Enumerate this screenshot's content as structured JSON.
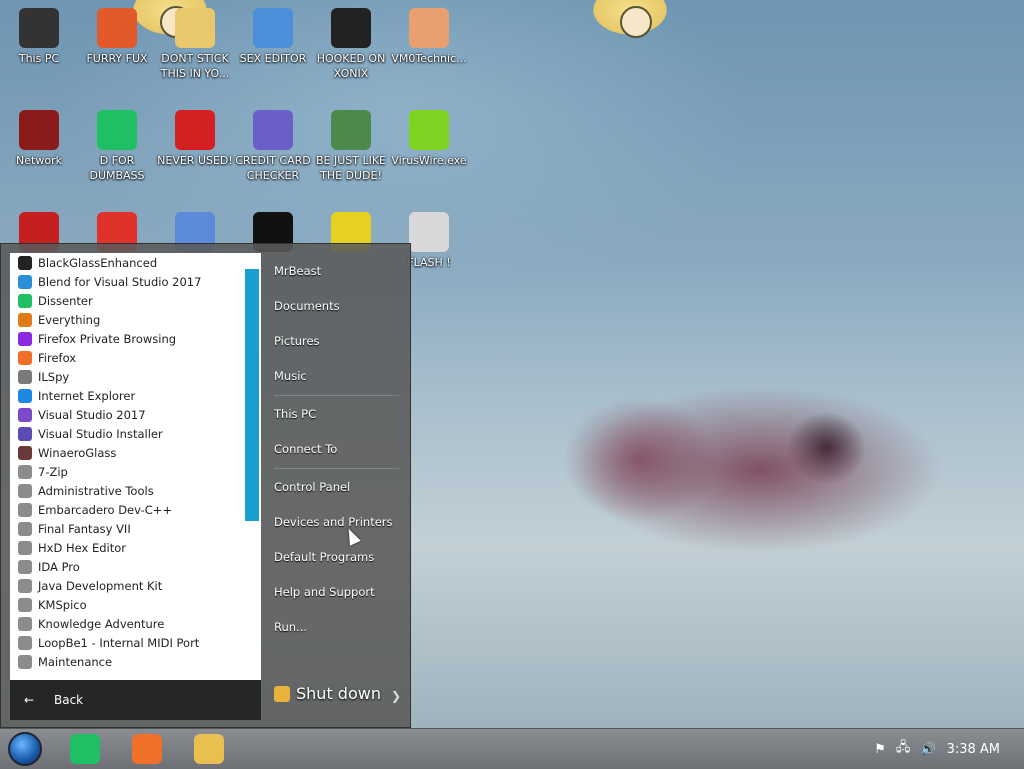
{
  "desktop": {
    "icons": [
      {
        "label": "This PC",
        "icon": "computer-icon",
        "color": "#333333"
      },
      {
        "label": "FURRY FUX",
        "icon": "app-icon",
        "color": "#e25a2a"
      },
      {
        "label": "DONT STICK THIS IN YO...",
        "icon": "cartoon-icon",
        "color": "#e8c86a"
      },
      {
        "label": "SEX EDITOR",
        "icon": "hxd-icon",
        "color": "#4a8fd8"
      },
      {
        "label": "HOOKED ON XONIX",
        "icon": "game-icon",
        "color": "#222222"
      },
      {
        "label": "VM0Technic...",
        "icon": "doctor-icon",
        "color": "#e8a070"
      },
      {
        "label": "Network",
        "icon": "network-icon",
        "color": "#8b1a1a"
      },
      {
        "label": "D FOR DUMBASS",
        "icon": "dissenter-icon",
        "color": "#1fbf63"
      },
      {
        "label": "NEVER USED!",
        "icon": "devcpp-icon",
        "color": "#d42020"
      },
      {
        "label": "CREDIT CARD CHECKER",
        "icon": "card-icon",
        "color": "#6a5fc9"
      },
      {
        "label": "BE JUST LIKE THE DUDE!",
        "icon": "dude-icon",
        "color": "#4c8a4c"
      },
      {
        "label": "VirusWire.exe",
        "icon": "lime-icon",
        "color": "#7ed321"
      },
      {
        "label": "",
        "icon": "red-button-icon",
        "color": "#c42020"
      },
      {
        "label": "",
        "icon": "p-icon",
        "color": "#e0322a"
      },
      {
        "label": "",
        "icon": "blue-tool-icon",
        "color": "#5a8ad8"
      },
      {
        "label": "",
        "icon": "cmd-icon",
        "color": "#111111"
      },
      {
        "label": "",
        "icon": "dog-icon",
        "color": "#e8d020"
      },
      {
        "label": "FLASH !",
        "icon": "flash-icon",
        "color": "#d8d8d8"
      }
    ]
  },
  "start_menu": {
    "programs": [
      {
        "label": "BlackGlassEnhanced",
        "color": "#222222"
      },
      {
        "label": "Blend for Visual Studio 2017",
        "color": "#2b8fd8"
      },
      {
        "label": "Dissenter",
        "color": "#1fbf63"
      },
      {
        "label": "Everything",
        "color": "#e07b1a"
      },
      {
        "label": "Firefox Private Browsing",
        "color": "#8a2be2"
      },
      {
        "label": "Firefox",
        "color": "#f0702a"
      },
      {
        "label": "ILSpy",
        "color": "#7a7a7a"
      },
      {
        "label": "Internet Explorer",
        "color": "#1e88e5"
      },
      {
        "label": "Visual Studio 2017",
        "color": "#7b4bc9"
      },
      {
        "label": "Visual Studio Installer",
        "color": "#5a4bb5"
      },
      {
        "label": "WinaeroGlass",
        "color": "#6a3a3a"
      },
      {
        "label": "7-Zip",
        "color": "#8c8c8c"
      },
      {
        "label": "Administrative Tools",
        "color": "#8c8c8c"
      },
      {
        "label": "Embarcadero Dev-C++",
        "color": "#8c8c8c"
      },
      {
        "label": "Final Fantasy VII",
        "color": "#8c8c8c"
      },
      {
        "label": "HxD Hex Editor",
        "color": "#8c8c8c"
      },
      {
        "label": "IDA Pro",
        "color": "#8c8c8c"
      },
      {
        "label": "Java Development Kit",
        "color": "#8c8c8c"
      },
      {
        "label": "KMSpico",
        "color": "#8c8c8c"
      },
      {
        "label": "Knowledge Adventure",
        "color": "#8c8c8c"
      },
      {
        "label": "LoopBe1 - Internal MIDI Port",
        "color": "#8c8c8c"
      },
      {
        "label": "Maintenance",
        "color": "#8c8c8c"
      }
    ],
    "back_label": "Back",
    "right_items": [
      "MrBeast",
      "Documents",
      "Pictures",
      "Music",
      "This PC",
      "Connect To",
      "Control Panel",
      "Devices and Printers",
      "Default Programs",
      "Help and Support",
      "Run..."
    ],
    "shutdown_label": "Shut down",
    "accent_color": "#1a9fd0"
  },
  "taskbar": {
    "apps": [
      {
        "name": "dissenter",
        "color": "#1fbf63"
      },
      {
        "name": "firefox",
        "color": "#f0702a"
      },
      {
        "name": "file-explorer",
        "color": "#e8c050"
      }
    ],
    "tray": {
      "flag": "⚑",
      "network": "🖧",
      "volume": "🔊"
    },
    "clock": "3:38 AM"
  }
}
